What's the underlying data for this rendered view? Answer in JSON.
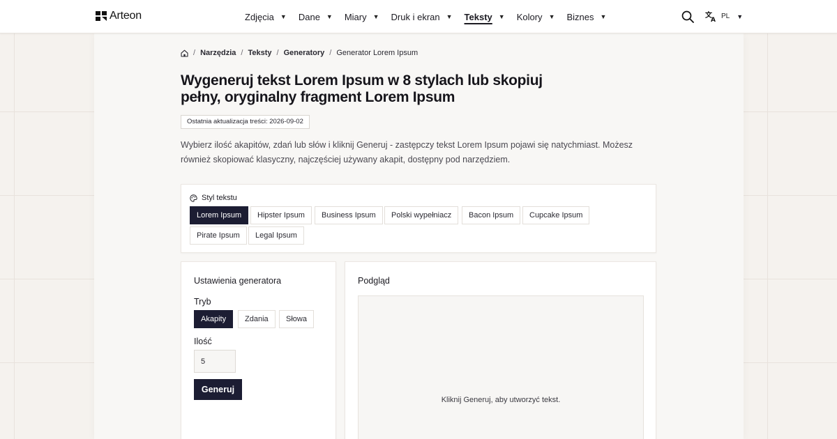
{
  "header": {
    "logo_text": "Arteon",
    "nav": [
      {
        "label": "Zdjęcia",
        "active": false
      },
      {
        "label": "Dane",
        "active": false
      },
      {
        "label": "Miary",
        "active": false
      },
      {
        "label": "Druk i ekran",
        "active": false
      },
      {
        "label": "Teksty",
        "active": true
      },
      {
        "label": "Kolory",
        "active": false
      },
      {
        "label": "Biznes",
        "active": false
      }
    ],
    "language": "PL",
    "icons": {
      "search": "search-icon",
      "language": "translate-icon",
      "home": "home-icon",
      "palette": "palette-icon"
    }
  },
  "breadcrumb": {
    "items": [
      "Narzędzia",
      "Teksty",
      "Generatory"
    ],
    "current": "Generator Lorem Ipsum"
  },
  "page": {
    "title": "Wygeneruj tekst Lorem Ipsum w 8 stylach lub skopiuj pełny, oryginalny fragment Lorem Ipsum",
    "updated": "Ostatnia aktualizacja treści: 2026-09-02",
    "intro": "Wybierz ilość akapitów, zdań lub słów i kliknij Generuj - zastępczy tekst Lorem Ipsum pojawi się natychmiast. Możesz również skopiować klasyczny, najczęściej używany akapit, dostępny pod narzędziem."
  },
  "style": {
    "heading": "Styl tekstu",
    "options": [
      "Lorem Ipsum",
      "Hipster Ipsum",
      "Business Ipsum",
      "Polski wypełniacz",
      "Bacon Ipsum",
      "Cupcake Ipsum",
      "Pirate Ipsum",
      "Legal Ipsum"
    ],
    "selected": "Lorem Ipsum"
  },
  "settings": {
    "title": "Ustawienia generatora",
    "mode_label": "Tryb",
    "modes": [
      "Akapity",
      "Zdania",
      "Słowa"
    ],
    "selected_mode": "Akapity",
    "quantity_label": "Ilość",
    "quantity_value": "5",
    "generate_label": "Generuj"
  },
  "preview": {
    "title": "Podgląd",
    "placeholder": "Kliknij Generuj, aby utworzyć tekst."
  },
  "colors": {
    "accent_dark": "#1c1d33",
    "background": "#f5f2ee",
    "card": "#ffffff"
  }
}
